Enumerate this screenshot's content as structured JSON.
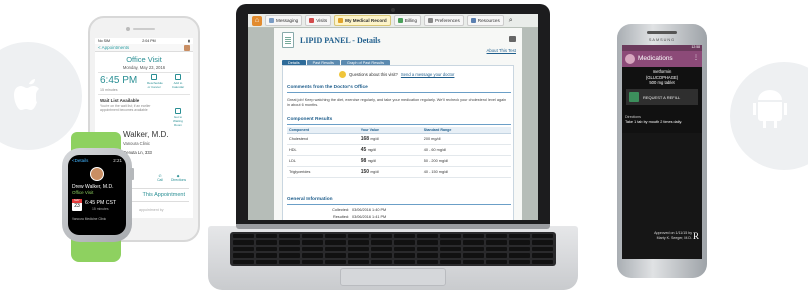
{
  "laptop_app": {
    "nav": {
      "items": [
        "Messaging",
        "Visits",
        "My Medical Record",
        "Billing",
        "Preferences",
        "Resources"
      ],
      "active_index": 2,
      "search_icon": "search-icon"
    },
    "page": {
      "title": "LIPID PANEL - Details",
      "about_link": "About This Test",
      "tabs": [
        "Details",
        "Past Results",
        "Graph of Past Results"
      ],
      "question": "Questions about this visit?",
      "question_link": "Send a message your doctor",
      "comments_heading": "Comments from the Doctor's Office",
      "comments_text": "Great job! Keep watching the diet, exercise regularly, and take your medication regularly. We'll recheck your cholesterol level again in about 6 months.",
      "results_heading": "Component Results",
      "columns": [
        "Component",
        "Your Value",
        "Standard Range"
      ],
      "rows": [
        {
          "component": "Cholesterol",
          "value": "168",
          "unit": "mg/dl",
          "range": "200 mg/dl"
        },
        {
          "component": "HDL",
          "value": "45",
          "unit": "mg/dl",
          "range": "40 - 60 mg/dl"
        },
        {
          "component": "LDL",
          "value": "98",
          "unit": "mg/dl",
          "range": "50 - 200 mg/dl"
        },
        {
          "component": "Triglycerides",
          "value": "150",
          "unit": "mg/dl",
          "range": "40 - 150 mg/dl"
        }
      ],
      "general_heading": "General Information",
      "collected_label": "Collected:",
      "collected_value": "03/06/2016 1:40 PM",
      "resulted_label": "Resulted:",
      "resulted_value": "03/06/2016 1:41 PM"
    }
  },
  "iphone_app": {
    "status_left": "No SIM",
    "status_time": "2:04 PM",
    "back_label": "< Appointments",
    "title": "Office Visit",
    "date": "Monday, May 23, 2016",
    "time": "6:45 PM",
    "duration": "15 minutes",
    "actions": [
      "Reschedule or Cancel",
      "Add to Calendar"
    ],
    "side_action": "Get to Waiting Room",
    "wait_title": "Wait List Available",
    "wait_text": "You're on the wait list; if an earlier appointment becomes available",
    "doctor": "Walker, M.D.",
    "clinic": "Vanoura Clinic",
    "address": "Genuta Ln, 333",
    "phone_label": "Call",
    "dir_label": "Directions",
    "cta": "This Appointment",
    "footer": "appointment by"
  },
  "watch_app": {
    "back_label": "<Details",
    "time": "2:21",
    "name": "Drew Walker, M.D.",
    "visit": "Office Visit",
    "cal_day": "MAY",
    "cal_date": "23",
    "when": "6:45 PM CST",
    "mins": "15 minutes",
    "clinic": "Vanoura Medicine Clinic"
  },
  "android_app": {
    "brand": "SAMSUNG",
    "status": "12:58",
    "title": "Medications",
    "med_name": "metformin",
    "med_brand": "(GLUCOPHAGE)",
    "med_dose": "500 mg tablet",
    "refill": "REQUEST A REFILL",
    "directions_heading": "Directions",
    "directions": "Take 1 tab by mouth 2 times daily.",
    "approved": "Approved on 1/11/15 by",
    "approved_by": "Marty K. Seeger, M.D.",
    "rx": "R"
  }
}
